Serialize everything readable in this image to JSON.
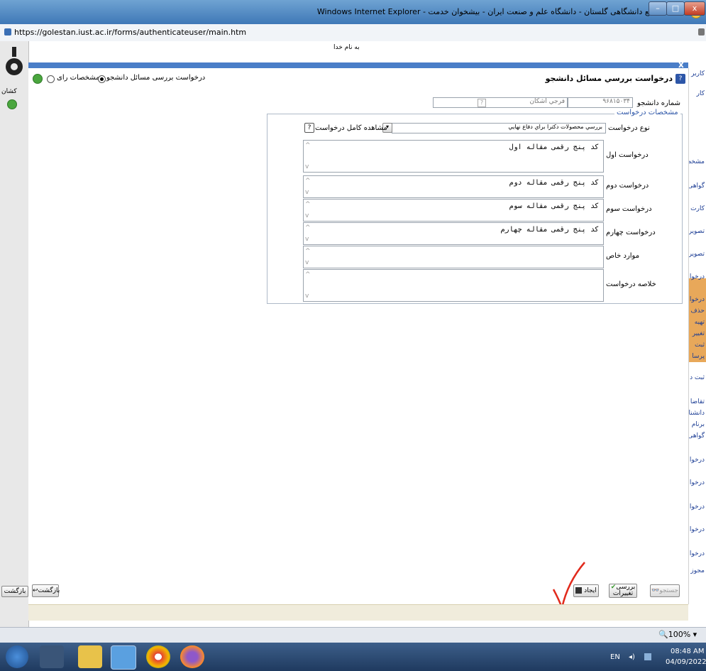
{
  "window": {
    "title": "سامانه جامع دانشگاهی گلستان - دانشگاه علم و صنعت ایران - بیشخوان خدمت - Windows Internet Explorer",
    "url": "https://golestan.iust.ac.ir/forms/authenticateuser/main.htm",
    "min_label": "–",
    "max_label": "□",
    "close_label": "x"
  },
  "banner": {
    "top_text": "به نام خدا"
  },
  "sidebar_left": {
    "user_label": "کشان"
  },
  "sidebar_right": {
    "items": [
      "کاربر",
      "کار",
      "مشخص",
      "گواهی",
      "کارت",
      "تصویر",
      "تصویر",
      "درخوا",
      "درخوا",
      "حذف",
      "تهیه",
      "تغییر",
      "ثبت",
      "پرسا",
      "ثبت د",
      "تقاضا",
      "دانشنا",
      "برنام",
      "گواهی",
      "درخوا",
      "درخوا",
      "درخوا",
      "درخوا",
      "درخوا",
      "مجوز"
    ]
  },
  "modal": {
    "close_label": "x",
    "title": "درخواست بررسي مسائل دانشجو",
    "radio_1": "درخواست بررسی مسائل دانشجو",
    "radio_2": "مشخصات رای"
  },
  "form": {
    "student_number_label": "شماره دانشجو",
    "student_number": "۹۶۸۱۵۰۳۴",
    "student_name": "فرجي اشكان",
    "legend": "مشخصات درخواست",
    "request_type_label": "نوع درخواست",
    "request_type_value": "بررسي محصولات دكترا براي دفاع نهايي",
    "view_full_label": "مشاهده کامل درخواست",
    "fields": [
      {
        "label": "درخواست اول",
        "value": "کد پنج رقمی مقاله اول"
      },
      {
        "label": "درخواست دوم",
        "value": "کد پنج رقمی مقاله دوم"
      },
      {
        "label": "درخواست سوم",
        "value": "کد پنج رقمی مقاله سوم"
      },
      {
        "label": "درخواست چهارم",
        "value": "کد پنج رقمی مقاله چهارم"
      },
      {
        "label": "موارد خاص",
        "value": ""
      },
      {
        "label": "خلاصه درخواست",
        "value": ""
      }
    ]
  },
  "toolbar": {
    "search_label": "جستجو",
    "review_label_1": "بررسی",
    "review_label_2": "تغییرات",
    "create_label": "ایجاد",
    "back_label": "بازگشت",
    "back_left_label": "بازگشت"
  },
  "status": {
    "zoom": "100%"
  },
  "taskbar": {
    "lang": "EN",
    "time": "08:48 AM",
    "date": "04/09/2022"
  }
}
